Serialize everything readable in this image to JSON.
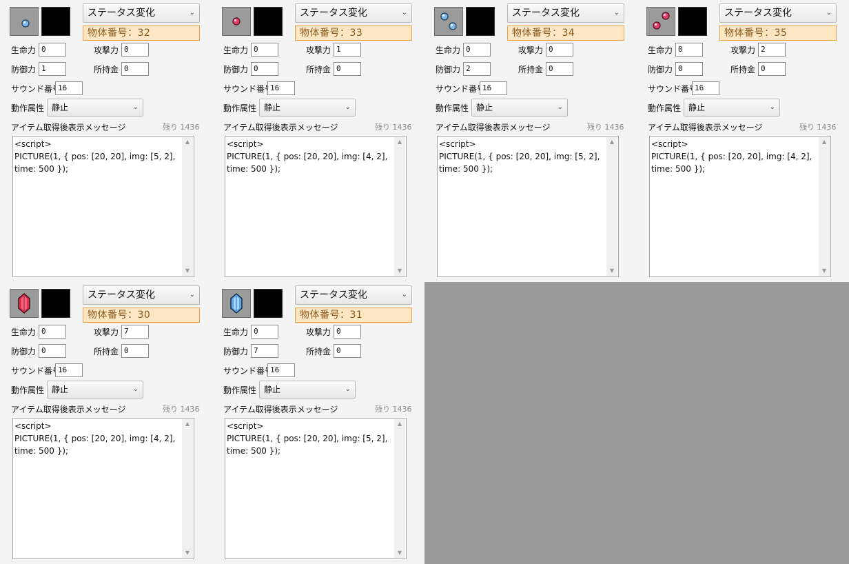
{
  "labels": {
    "life": "生命力",
    "attack": "攻撃力",
    "defense": "防御力",
    "money": "所持金",
    "sound": "サウンド番号",
    "motion": "動作属性",
    "message": "アイテム取得後表示メッセージ",
    "remaining": "残り 1436"
  },
  "panels": [
    {
      "type": "ステータス変化",
      "obj_num": "物体番号：32",
      "icon": "blue-orb-icon",
      "life": "0",
      "attack": "0",
      "defense": "1",
      "money": "0",
      "sound": "16",
      "motion": "静止",
      "message": "<script>\nPICTURE(1, { pos: [20, 20], img: [5, 2], time: 500 });"
    },
    {
      "type": "ステータス変化",
      "obj_num": "物体番号：33",
      "icon": "red-orb-icon",
      "life": "0",
      "attack": "1",
      "defense": "0",
      "money": "0",
      "sound": "16",
      "motion": "静止",
      "message": "<script>\nPICTURE(1, { pos: [20, 20], img: [4, 2], time: 500 });"
    },
    {
      "type": "ステータス変化",
      "obj_num": "物体番号：34",
      "icon": "blue-orbs-pair-icon",
      "life": "0",
      "attack": "0",
      "defense": "2",
      "money": "0",
      "sound": "16",
      "motion": "静止",
      "message": "<script>\nPICTURE(1, { pos: [20, 20], img: [5, 2], time: 500 });"
    },
    {
      "type": "ステータス変化",
      "obj_num": "物体番号：35",
      "icon": "red-orbs-pair-icon",
      "life": "0",
      "attack": "2",
      "defense": "0",
      "money": "0",
      "sound": "16",
      "motion": "静止",
      "message": "<script>\nPICTURE(1, { pos: [20, 20], img: [4, 2], time: 500 });"
    },
    {
      "type": "ステータス変化",
      "obj_num": "物体番号：30",
      "icon": "red-gem-icon",
      "life": "0",
      "attack": "7",
      "defense": "0",
      "money": "0",
      "sound": "16",
      "motion": "静止",
      "message": "<script>\nPICTURE(1, { pos: [20, 20], img: [4, 2], time: 500 });"
    },
    {
      "type": "ステータス変化",
      "obj_num": "物体番号：31",
      "icon": "blue-gem-icon",
      "life": "0",
      "attack": "0",
      "defense": "7",
      "money": "0",
      "sound": "16",
      "motion": "静止",
      "message": "<script>\nPICTURE(1, { pos: [20, 20], img: [5, 2], time: 500 });"
    }
  ],
  "colors": {
    "orb_blue": "#7fb6e8",
    "orb_red": "#e0406a",
    "obj_num_bg": "#fde6c4",
    "obj_num_border": "#e6a146",
    "empty_area": "#9a9a9a"
  }
}
